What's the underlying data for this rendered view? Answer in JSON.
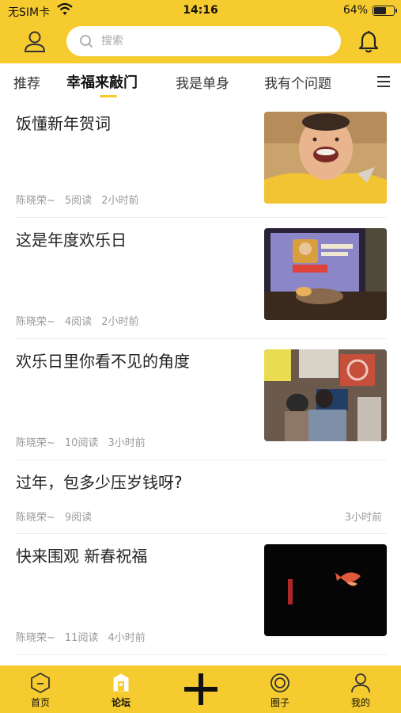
{
  "status_bar": {
    "carrier": "无SIM卡",
    "time": "14:16",
    "battery_percent": "64%",
    "battery_level": 0.64
  },
  "header": {
    "search_placeholder": "搜索",
    "accent_color": "#f6cb2f"
  },
  "tabs": [
    {
      "label": "推荐",
      "active": false
    },
    {
      "label": "幸福来敲门",
      "active": true
    },
    {
      "label": "我是单身",
      "active": false
    },
    {
      "label": "我有个问题",
      "active": false
    }
  ],
  "articles": [
    {
      "title": "饭懂新年贺词",
      "author": "陈晓荣~",
      "reads": "5阅读",
      "time": "2小时前",
      "thumbnail": "man-laughing-photo"
    },
    {
      "title": "这是年度欢乐日",
      "author": "陈晓荣~",
      "reads": "4阅读",
      "time": "2小时前",
      "thumbnail": "stage-banner-photo"
    },
    {
      "title": "欢乐日里你看不见的角度",
      "author": "陈晓荣~",
      "reads": "10阅读",
      "time": "3小时前",
      "thumbnail": "studio-crew-photo"
    },
    {
      "title": "过年，包多少压岁钱呀?",
      "author": "陈晓荣~",
      "reads": "9阅读",
      "time": "3小时前",
      "thumbnail": null
    },
    {
      "title": "快来围观 新春祝福",
      "author": "陈晓荣~",
      "reads": "11阅读",
      "time": "4小时前",
      "thumbnail": "koi-video-still"
    }
  ],
  "bottom_nav": [
    {
      "label": "首页",
      "icon": "home-hexagon-icon",
      "active": false
    },
    {
      "label": "论坛",
      "icon": "forum-icon",
      "active": true
    },
    {
      "label": "",
      "icon": "plus-icon",
      "active": false
    },
    {
      "label": "圈子",
      "icon": "circle-icon",
      "active": false
    },
    {
      "label": "我的",
      "icon": "profile-icon",
      "active": false
    }
  ]
}
